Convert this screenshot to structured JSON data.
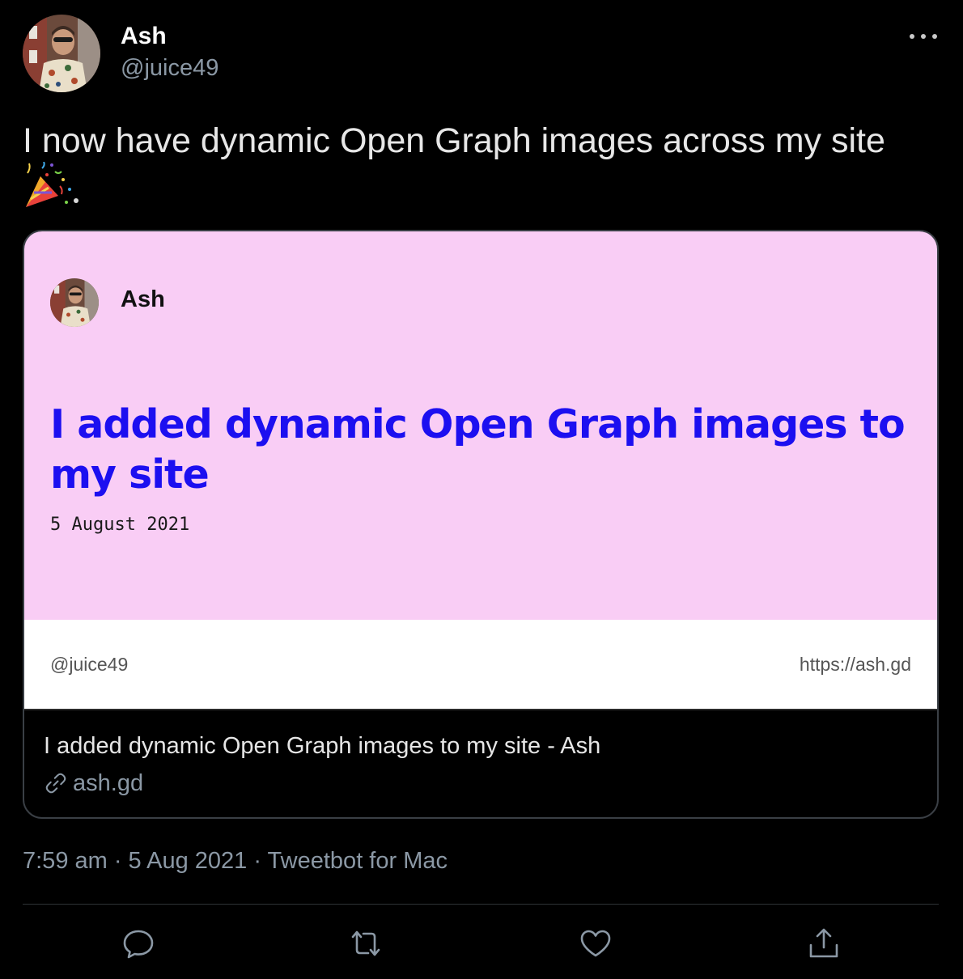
{
  "tweet": {
    "author": {
      "name": "Ash",
      "handle": "@juice49"
    },
    "text": "I now have dynamic Open Graph images across my site",
    "emoji": "party-popper",
    "meta": "7:59 am · 5 Aug 2021 · Tweetbot for Mac"
  },
  "card": {
    "image": {
      "author": "Ash",
      "title": "I added dynamic Open Graph images to my site",
      "date": "5 August 2021",
      "handle": "@juice49",
      "url": "https://ash.gd",
      "background": "#f9cdf5",
      "title_color": "#1c0ff0"
    },
    "title": "I added dynamic Open Graph images to my site - Ash",
    "domain": "ash.gd"
  },
  "actions": [
    "reply-icon",
    "retweet-icon",
    "like-icon",
    "share-icon"
  ],
  "colors": {
    "background": "#000000",
    "muted": "#8b98a5",
    "border": "#3a3f45"
  }
}
